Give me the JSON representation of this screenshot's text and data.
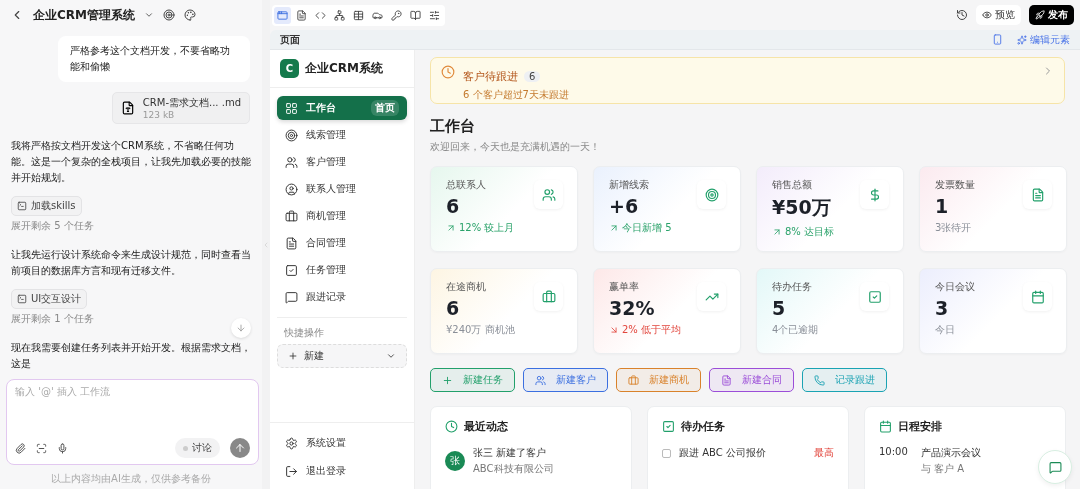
{
  "chat": {
    "title": "企业CRM管理系统",
    "messages": [
      {
        "kind": "user",
        "text": "严格参考这个文档开发，不要省略功能和偷懒"
      },
      {
        "kind": "file",
        "name": "CRM-需求文档... .md",
        "size": "123 kB"
      },
      {
        "kind": "assistant",
        "text": "我将严格按文档开发这个CRM系统，不省略任何功能。这是一个复杂的全栈项目，让我先加载必要的技能并开始规划。"
      },
      {
        "kind": "tool",
        "label": "加载skills",
        "expand": "展开剩余 5 个任务"
      },
      {
        "kind": "assistant",
        "text": "让我先运行设计系统命令来生成设计规范，同时查看当前项目的数据库方言和现有迁移文件。"
      },
      {
        "kind": "tool",
        "label": "UI交互设计",
        "expand": "展开剩余 1 个任务"
      },
      {
        "kind": "assistant",
        "text": "现在我需要创建任务列表并开始开发。根据需求文档，这是"
      }
    ],
    "input": {
      "placeholder": "输入 '@' 插入 工作流"
    },
    "mode": "讨论",
    "footer": "以上内容均由AI生成，仅供参考备份"
  },
  "toolbar": {
    "tabs": [
      {
        "kind": "browser",
        "selected": true
      },
      {
        "kind": "file",
        "selected": false
      },
      {
        "kind": "code",
        "selected": false
      },
      {
        "kind": "tree",
        "selected": false
      },
      {
        "kind": "table",
        "selected": false
      },
      {
        "kind": "car",
        "selected": false
      },
      {
        "kind": "key",
        "selected": false
      },
      {
        "kind": "book",
        "selected": false
      },
      {
        "kind": "sliders",
        "selected": false
      }
    ],
    "preview": "预览",
    "publish": "发布"
  },
  "preview_bar": {
    "label": "页面",
    "edit": "编辑元素"
  },
  "sidebar": {
    "brand_letter": "C",
    "brand": "企业CRM系统",
    "nav": [
      {
        "label": "工作台",
        "selected": true,
        "badge": "首页"
      },
      {
        "label": "线索管理",
        "selected": false
      },
      {
        "label": "客户管理",
        "selected": false
      },
      {
        "label": "联系人管理",
        "selected": false
      },
      {
        "label": "商机管理",
        "selected": false
      },
      {
        "label": "合同管理",
        "selected": false
      },
      {
        "label": "任务管理",
        "selected": false
      },
      {
        "label": "跟进记录",
        "selected": false
      }
    ],
    "quick_label": "快捷操作",
    "new_button": "新建",
    "footer": [
      {
        "label": "系统设置"
      },
      {
        "label": "退出登录"
      }
    ]
  },
  "alert": {
    "title": "客户待跟进",
    "count": "6",
    "text": "6 个客户超过7天未跟进"
  },
  "heading": "工作台",
  "subtitle": "欢迎回来，今天也是充满机遇的一天！",
  "stats": [
    {
      "label": "总联系人",
      "value": "6",
      "note": "12% 较上月",
      "kind": "up"
    },
    {
      "label": "新增线索",
      "value": "+6",
      "note": "今日新增 5",
      "kind": "up"
    },
    {
      "label": "销售总额",
      "value": "¥50万",
      "note": "8% 达目标",
      "kind": "up"
    },
    {
      "label": "发票数量",
      "value": "1",
      "note": "3张待开",
      "kind": "plain"
    },
    {
      "label": "在途商机",
      "value": "6",
      "note": "¥240万 商机池",
      "kind": "plain"
    },
    {
      "label": "赢单率",
      "value": "32%",
      "note": "2% 低于平均",
      "kind": "down"
    },
    {
      "label": "待办任务",
      "value": "5",
      "note": "4个已逾期",
      "kind": "plain"
    },
    {
      "label": "今日会议",
      "value": "3",
      "note": "今日",
      "kind": "plain"
    }
  ],
  "actions": [
    {
      "label": "新建任务",
      "color": "#22a06b"
    },
    {
      "label": "新建客户",
      "color": "#3b6fe0"
    },
    {
      "label": "新建商机",
      "color": "#d9822b"
    },
    {
      "label": "新建合同",
      "color": "#9b4dd8"
    },
    {
      "label": "记录跟进",
      "color": "#1aa3b3"
    }
  ],
  "panels": {
    "recent": {
      "title": "最近动态",
      "items": [
        {
          "avatar": "张",
          "text": "张三 新建了客户",
          "sub": "ABC科技有限公司"
        }
      ]
    },
    "tasks": {
      "title": "待办任务",
      "items": [
        {
          "text": "跟进 ABC 公司报价",
          "checked": false,
          "priority": "最高"
        }
      ]
    },
    "schedule": {
      "title": "日程安排",
      "items": [
        {
          "time": "10:00",
          "title": "产品演示会议",
          "sub": "与 客户 A"
        }
      ]
    }
  }
}
